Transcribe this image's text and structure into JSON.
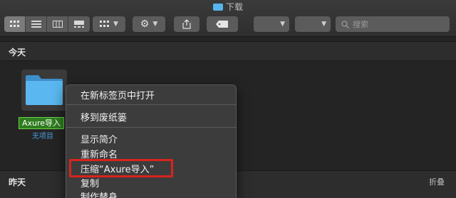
{
  "window": {
    "title": "下载"
  },
  "toolbar": {
    "view_modes": [
      "icon-view",
      "list-view",
      "column-view",
      "gallery-view"
    ],
    "search_placeholder": "搜索"
  },
  "sections": [
    {
      "label": "今天"
    },
    {
      "label": "昨天",
      "collapse_label": "折叠"
    }
  ],
  "file": {
    "name": "Axure导入",
    "subtitle": "无项目"
  },
  "context_menu": {
    "items": [
      "在新标签页中打开",
      "移到废纸篓",
      "显示简介",
      "重新命名",
      "压缩“Axure导入”",
      "复制",
      "制作替身"
    ],
    "highlighted_item": "压缩“Axure导入”"
  },
  "colors": {
    "accent_folder": "#56b5ec",
    "highlight_box": "#d9231d",
    "selection_green": "#2e7d1e"
  }
}
